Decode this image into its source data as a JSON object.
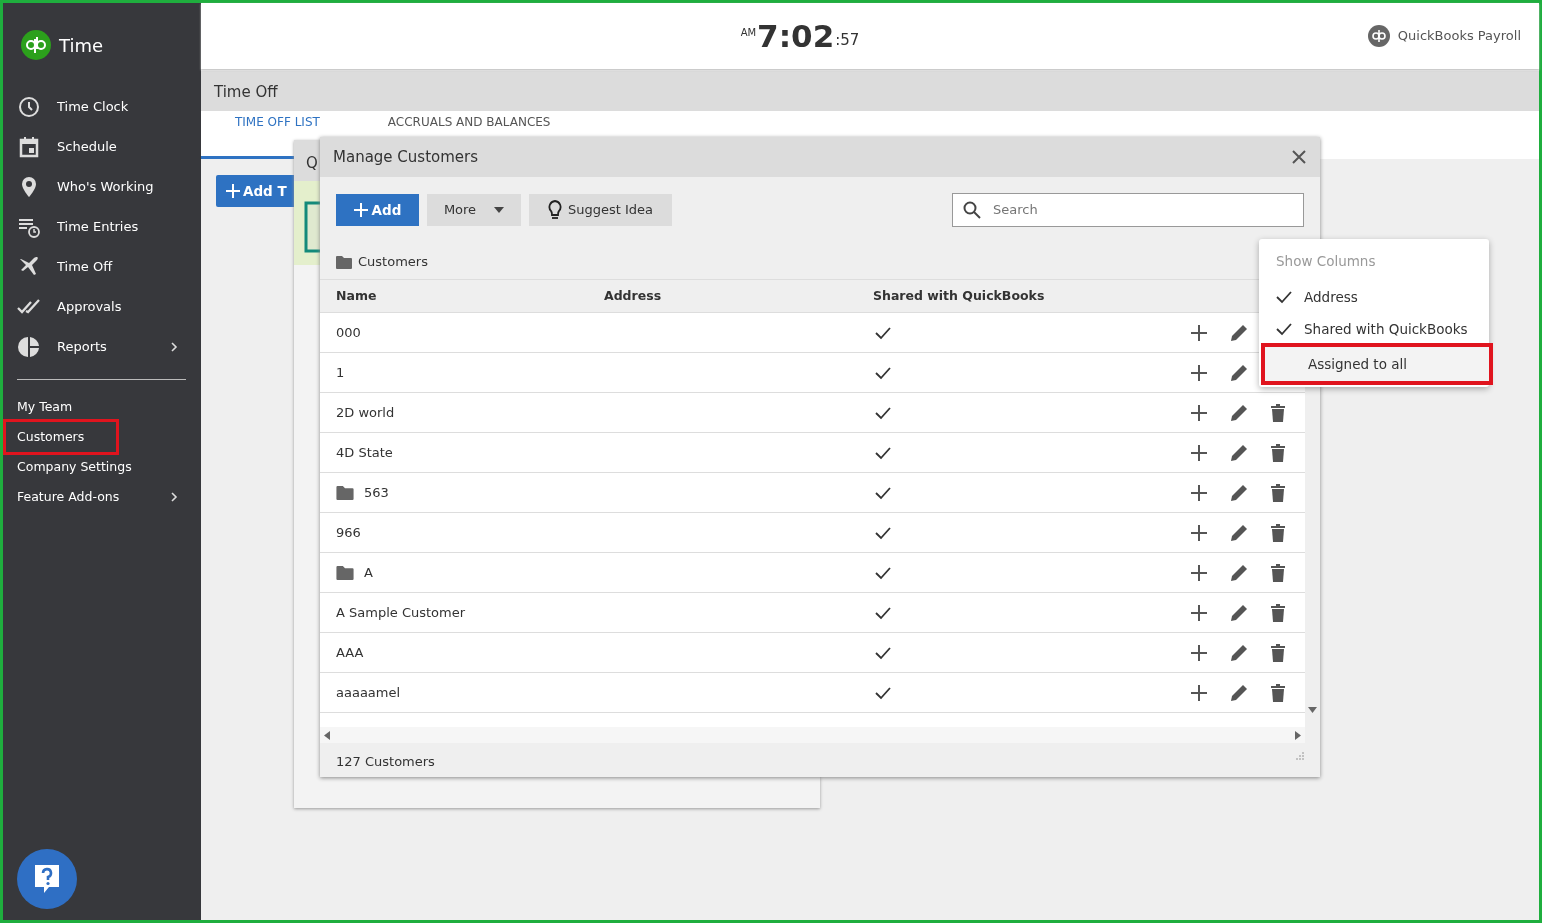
{
  "app": {
    "name": "Time"
  },
  "sidebar": {
    "items": [
      {
        "label": "Time Clock",
        "has_submenu": false
      },
      {
        "label": "Schedule",
        "has_submenu": false
      },
      {
        "label": "Who's Working",
        "has_submenu": false
      },
      {
        "label": "Time Entries",
        "has_submenu": false
      },
      {
        "label": "Time Off",
        "has_submenu": false
      },
      {
        "label": "Approvals",
        "has_submenu": false
      },
      {
        "label": "Reports",
        "has_submenu": true
      }
    ],
    "links": [
      {
        "label": "My Team",
        "highlighted": false,
        "has_submenu": false
      },
      {
        "label": "Customers",
        "highlighted": true,
        "has_submenu": false
      },
      {
        "label": "Company Settings",
        "highlighted": false,
        "has_submenu": false
      },
      {
        "label": "Feature Add-ons",
        "highlighted": false,
        "has_submenu": true
      }
    ]
  },
  "header": {
    "meridiem": "AM",
    "time": "7:02",
    "seconds": ":57",
    "product": "QuickBooks Payroll"
  },
  "page": {
    "title": "Time Off",
    "tabs": [
      {
        "label": "TIME OFF LIST",
        "selected": true
      },
      {
        "label": "ACCRUALS AND BALANCES",
        "selected": false
      }
    ],
    "add_button": "Add T"
  },
  "back_dialog": {
    "title": "Q"
  },
  "dialog": {
    "title": "Manage Customers",
    "add": "Add",
    "more": "More",
    "suggest": "Suggest Idea",
    "search_placeholder": "Search",
    "breadcrumb": "Customers",
    "columns": [
      "Name",
      "Address",
      "Shared with QuickBooks"
    ],
    "rows": [
      {
        "name": "000",
        "folder": false,
        "shared": true
      },
      {
        "name": "1",
        "folder": false,
        "shared": true
      },
      {
        "name": "2D world",
        "folder": false,
        "shared": true
      },
      {
        "name": "4D State",
        "folder": false,
        "shared": true
      },
      {
        "name": "563",
        "folder": true,
        "shared": true
      },
      {
        "name": "966",
        "folder": false,
        "shared": true
      },
      {
        "name": "A",
        "folder": true,
        "shared": true
      },
      {
        "name": "A Sample Customer",
        "folder": false,
        "shared": true
      },
      {
        "name": "AAA",
        "folder": false,
        "shared": true
      },
      {
        "name": "aaaaamel",
        "folder": false,
        "shared": true
      }
    ],
    "footer": "127 Customers"
  },
  "column_menu": {
    "title": "Show Columns",
    "items": [
      {
        "label": "Address",
        "checked": true,
        "highlighted": false
      },
      {
        "label": "Shared with QuickBooks",
        "checked": true,
        "highlighted": false
      },
      {
        "label": "Assigned to all",
        "checked": false,
        "highlighted": true
      }
    ]
  }
}
